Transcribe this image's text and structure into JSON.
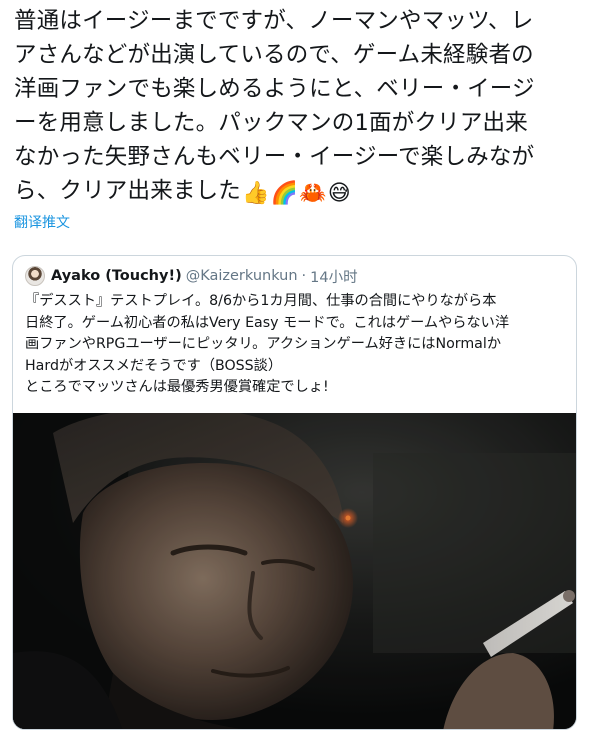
{
  "tweet": {
    "lines": [
      "普通はイージーまでですが、ノーマンやマッツ、レ",
      "アさんなどが出演しているので、ゲーム未経験者の",
      "洋画ファンでも楽しめるようにと、ベリー・イージ",
      "ーを用意しました。パックマンの1面がクリア出来",
      "なかった矢野さんもベリー・イージーで楽しみなが",
      "ら、クリア出来ました"
    ],
    "emojis": [
      "👍",
      "🌈",
      "🦀",
      "😅"
    ],
    "translate_label": "翻译推文"
  },
  "quote": {
    "author_name": "Ayako (Touchy!)",
    "author_handle": "@Kaizerkunkun",
    "separator": "·",
    "time": "14小时",
    "lines": [
      "『デススト』テストプレイ。8/6から1カ月間、仕事の合間にやりながら本",
      "日終了。ゲーム初心者の私はVery Easy モードで。これはゲームやらない洋",
      "画ファンやRPGユーザーにピッタリ。アクションゲーム好きにはNormalか",
      "Hardがオススメだそうです（BOSS談）",
      "ところでマッツさんは最優秀男優賞確定でしょ!"
    ]
  },
  "colors": {
    "text": "#14171a",
    "link": "#1b95e0",
    "muted": "#657786",
    "border": "#ccd6dd"
  },
  "icons": {
    "avatar": "user-avatar"
  }
}
